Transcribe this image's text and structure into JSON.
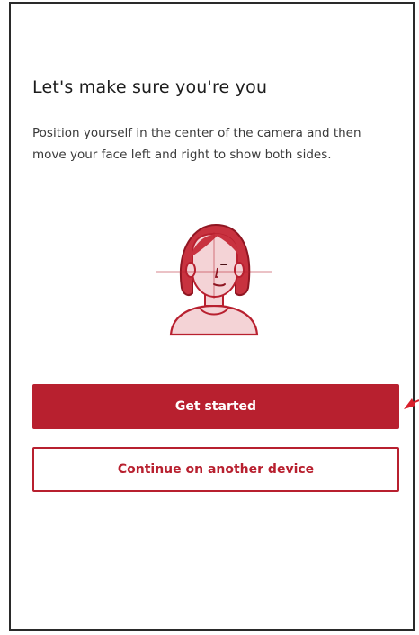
{
  "screen": {
    "title": "Let's make sure you're you",
    "instructions": "Position yourself in the center of the camera and then move your face left and right to show both sides."
  },
  "illustration": {
    "icon": "face-scan-icon"
  },
  "actions": {
    "primary_label": "Get started",
    "secondary_label": "Continue on another device"
  },
  "colors": {
    "accent": "#b8202f",
    "face_fill": "#f4d3d6",
    "hair": "#c8323f"
  }
}
